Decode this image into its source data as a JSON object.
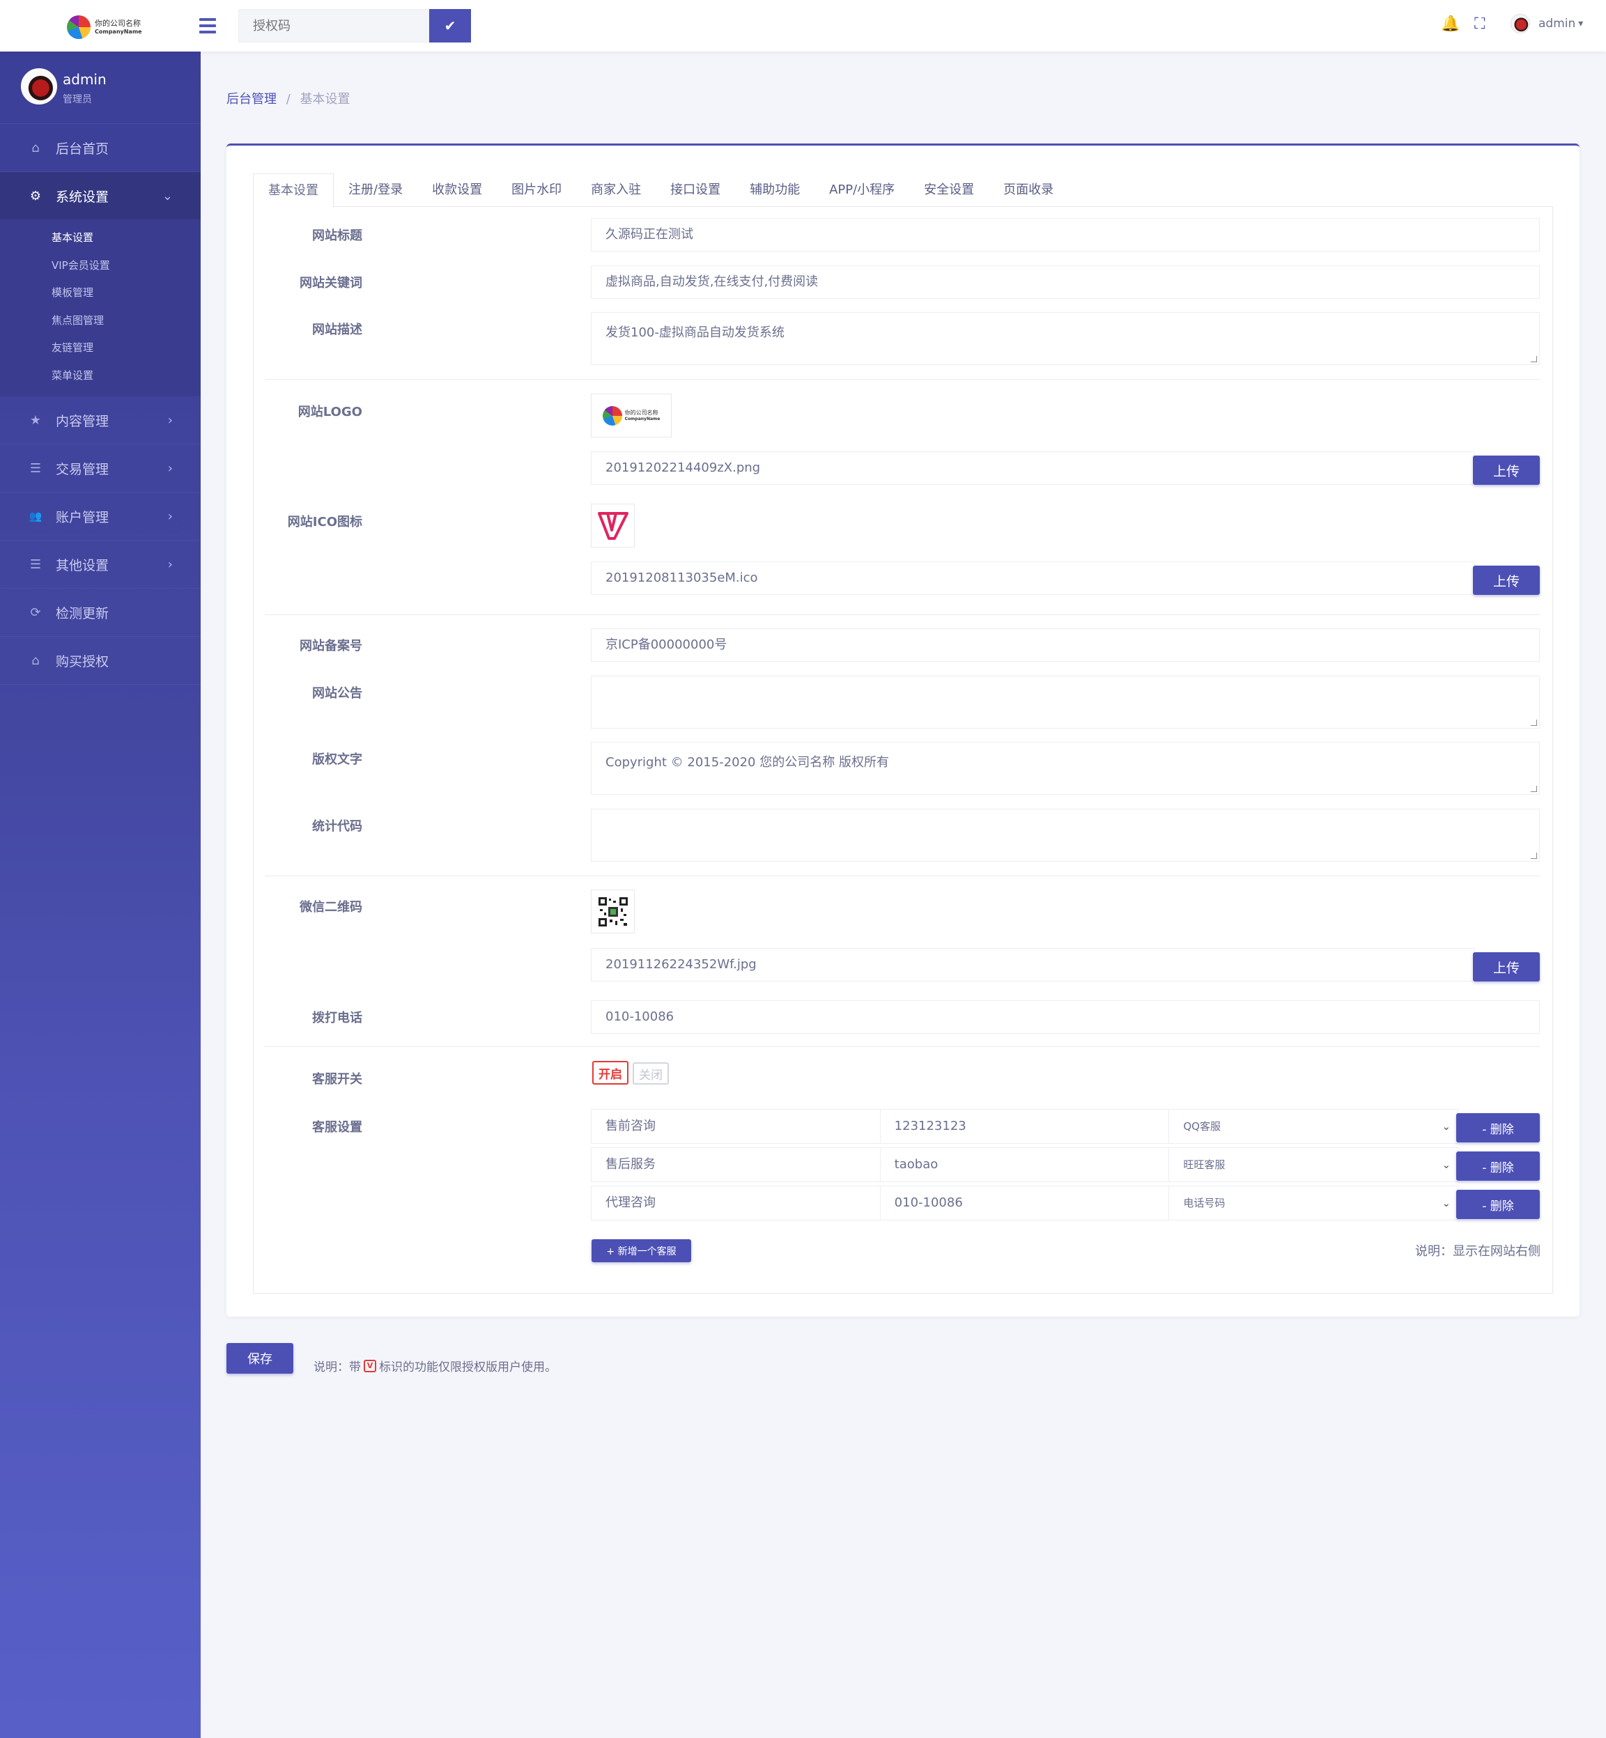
{
  "header": {
    "logo_cn": "你的公司名称",
    "logo_en": "CompanyName",
    "auth_placeholder": "授权码",
    "auth_confirm_icon": "✔",
    "bell_icon": "🔔",
    "fullscreen_icon": "⛶",
    "user": "admin",
    "dropdown_icon": "▾"
  },
  "sidebar": {
    "user_name": "admin",
    "user_role": "管理员",
    "items": [
      {
        "label": "后台首页",
        "icon": "home-icon",
        "glyph": "⌂"
      },
      {
        "label": "系统设置",
        "icon": "gear-icon",
        "glyph": "⚙",
        "chev": "⌄"
      },
      {
        "label": "内容管理",
        "icon": "star-icon",
        "glyph": "★",
        "chev": "›"
      },
      {
        "label": "交易管理",
        "icon": "list-icon",
        "glyph": "☰",
        "chev": "›"
      },
      {
        "label": "账户管理",
        "icon": "users-icon",
        "glyph": "👥",
        "chev": "›"
      },
      {
        "label": "其他设置",
        "icon": "list-icon",
        "glyph": "☰",
        "chev": "›"
      },
      {
        "label": "检测更新",
        "icon": "refresh-icon",
        "glyph": "⟳"
      },
      {
        "label": "购买授权",
        "icon": "home-icon",
        "glyph": "⌂"
      }
    ],
    "submenu": [
      "基本设置",
      "VIP会员设置",
      "模板管理",
      "焦点图管理",
      "友链管理",
      "菜单设置"
    ]
  },
  "breadcrumb": {
    "home": "后台管理",
    "sep": "/",
    "current": "基本设置"
  },
  "tabs": [
    "基本设置",
    "注册/登录",
    "收款设置",
    "图片水印",
    "商家入驻",
    "接口设置",
    "辅助功能",
    "APP/小程序",
    "安全设置",
    "页面收录"
  ],
  "form": {
    "site_title_label": "网站标题",
    "site_title": "久源码正在测试",
    "keywords_label": "网站关键词",
    "keywords": "虚拟商品,自动发货,在线支付,付费阅读",
    "desc_label": "网站描述",
    "desc": "发货100-虚拟商品自动发货系统",
    "logo_label": "网站LOGO",
    "logo_file": "20191202214409zX.png",
    "ico_label": "网站ICO图标",
    "ico_file": "20191208113035eM.ico",
    "upload_label": "上传",
    "icp_label": "网站备案号",
    "icp": "京ICP备00000000号",
    "notice_label": "网站公告",
    "notice": "",
    "copyright_label": "版权文字",
    "copyright": "Copyright © 2015-2020 您的公司名称 版权所有",
    "stats_label": "统计代码",
    "stats": "",
    "wechat_label": "微信二维码",
    "wechat_file": "20191126224352Wf.jpg",
    "phone_label": "拨打电话",
    "phone": "010-10086",
    "cs_switch_label": "客服开关",
    "cs_on": "开启",
    "cs_off": "关闭",
    "cs_settings_label": "客服设置",
    "cs_rows": [
      {
        "name": "售前咨询",
        "value": "123123123",
        "type": "QQ客服"
      },
      {
        "name": "售后服务",
        "value": "taobao",
        "type": "旺旺客服"
      },
      {
        "name": "代理咨询",
        "value": "010-10086",
        "type": "电话号码"
      }
    ],
    "delete_label": "- 删除",
    "add_label": "+ 新增一个客服",
    "cs_note": "说明：显示在网站右侧"
  },
  "footer": {
    "save_label": "保存",
    "note_prefix": "说明：带",
    "note_badge": "V",
    "note_suffix": "标识的功能仅限授权版用户使用。"
  },
  "colors": {
    "primary": "#4c50b5",
    "sidebar": "#3c3f97",
    "danger": "#e53935"
  }
}
